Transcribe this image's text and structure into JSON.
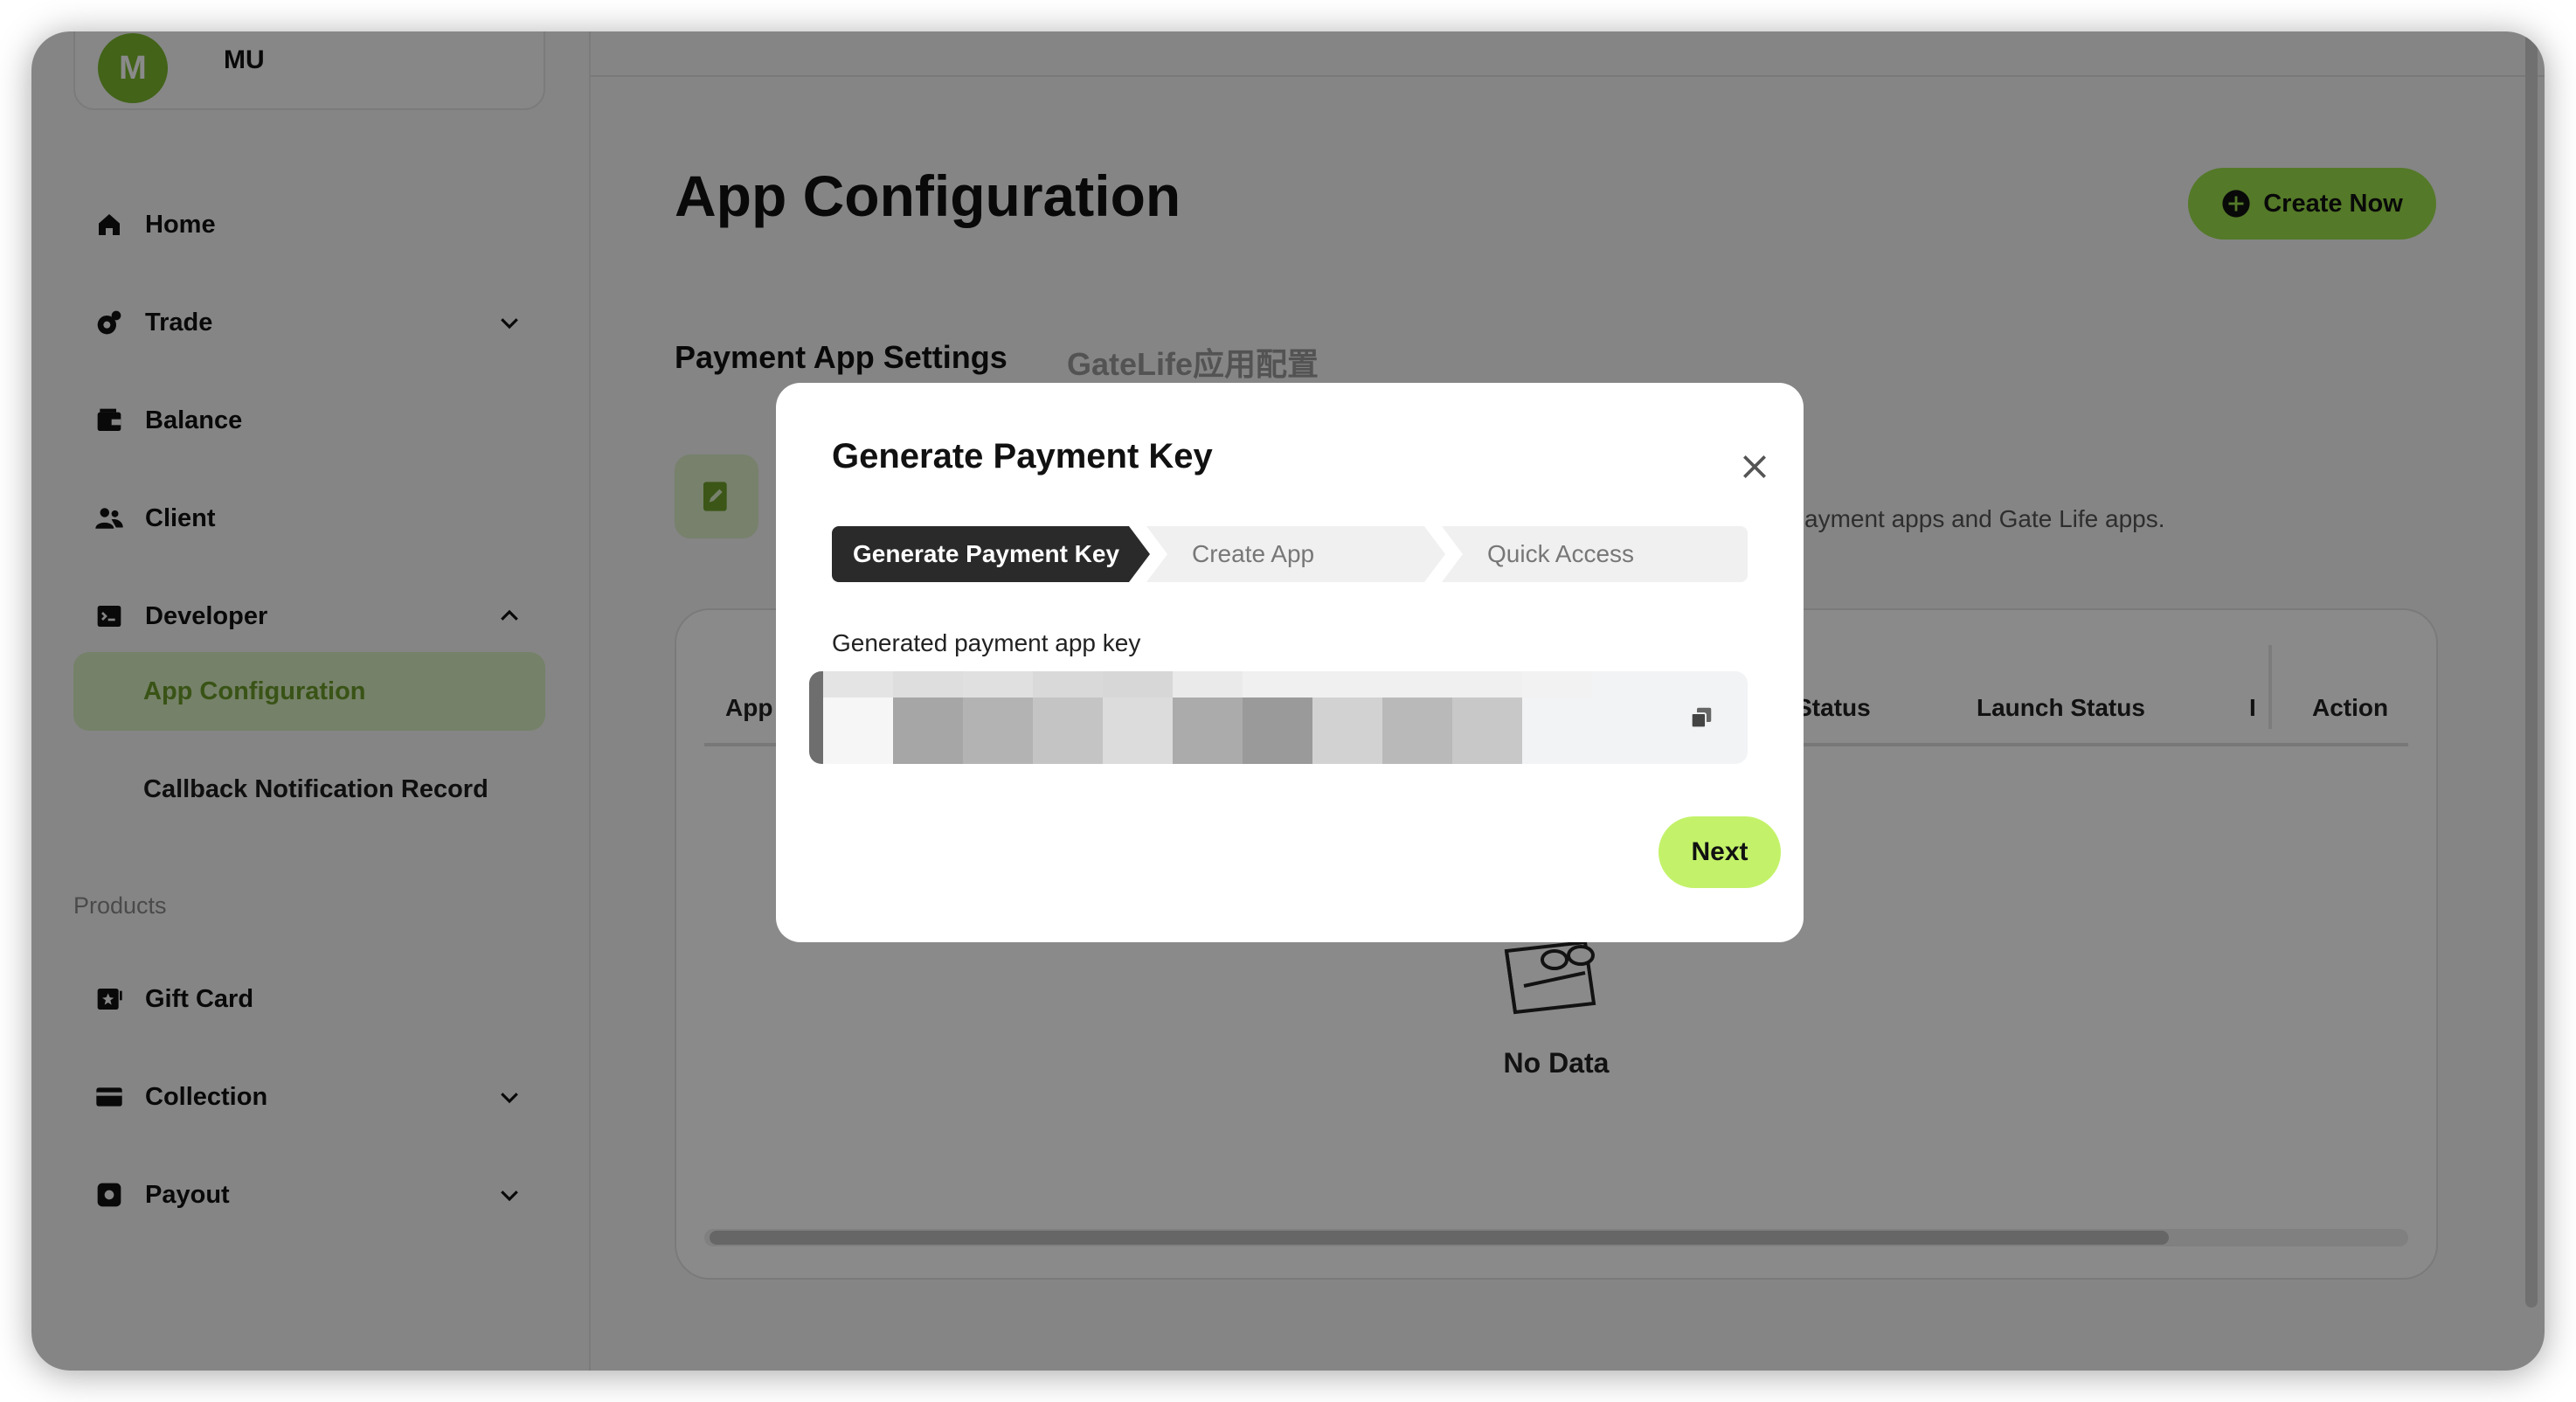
{
  "user": {
    "avatar_letter": "M",
    "name": "MU"
  },
  "sidebar": {
    "items": [
      {
        "label": "Home",
        "icon": "home-icon"
      },
      {
        "label": "Trade",
        "icon": "trade-icon"
      },
      {
        "label": "Balance",
        "icon": "wallet-icon"
      },
      {
        "label": "Client",
        "icon": "users-icon"
      },
      {
        "label": "Developer",
        "icon": "terminal-icon"
      }
    ],
    "developer_sub": [
      {
        "label": "App Configuration",
        "active": true
      },
      {
        "label": "Callback Notification Record",
        "active": false
      }
    ],
    "products_label": "Products",
    "product_items": [
      {
        "label": "Gift Card",
        "icon": "gift-card-icon"
      },
      {
        "label": "Collection",
        "icon": "card-icon"
      },
      {
        "label": "Payout",
        "icon": "payout-icon"
      }
    ]
  },
  "main": {
    "title": "App Configuration",
    "create_button": "Create Now",
    "tabs": [
      {
        "label": "Payment App Settings",
        "active": true
      },
      {
        "label": "GateLife应用配置",
        "active": false
      }
    ],
    "notice_visible_text": "tal, including payment apps and Gate Life apps.",
    "table": {
      "headers": [
        "App",
        "ew Status",
        "Launch Status",
        "I",
        "Action"
      ],
      "empty_text": "No Data"
    }
  },
  "modal": {
    "title": "Generate Payment Key",
    "steps": [
      {
        "label": "Generate Payment Key",
        "state": "active"
      },
      {
        "label": "Create App",
        "state": "pending"
      },
      {
        "label": "Quick Access",
        "state": "pending"
      }
    ],
    "key_label": "Generated payment app key",
    "next_button": "Next"
  },
  "colors": {
    "brand_green": "#9be04a",
    "next_green": "#c3f26a",
    "active_step": "#2a2a2a"
  }
}
